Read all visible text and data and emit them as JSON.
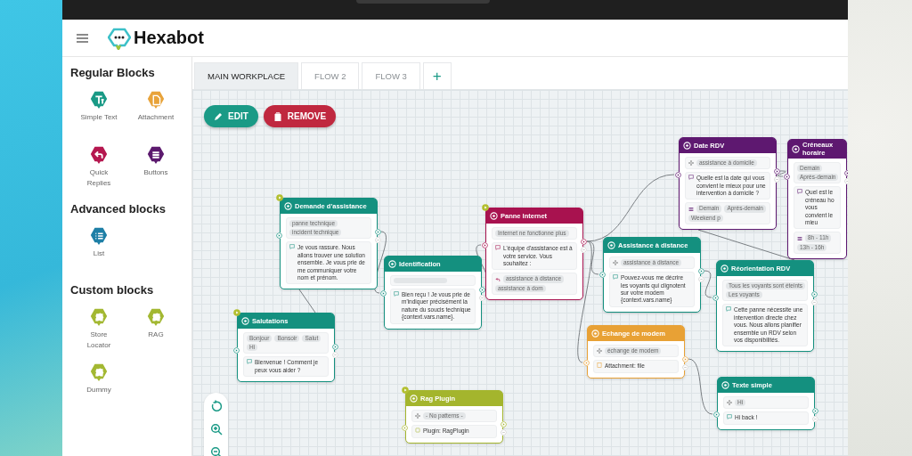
{
  "header": {
    "title": "Hexabot"
  },
  "sidebar": {
    "sections": [
      {
        "title": "Regular Blocks",
        "blocks": [
          {
            "label": "Simple Text",
            "kind": "text",
            "color": "#1a9a86"
          },
          {
            "label": "Attachment",
            "kind": "attachment",
            "color": "#e8a33a"
          },
          {
            "label": "Quick Replies",
            "kind": "quick_replies",
            "color": "#b5174f"
          },
          {
            "label": "Buttons",
            "kind": "buttons",
            "color": "#5c1a6e"
          }
        ]
      },
      {
        "title": "Advanced blocks",
        "blocks": [
          {
            "label": "List",
            "kind": "list",
            "color": "#1e7fa6"
          }
        ]
      },
      {
        "title": "Custom blocks",
        "blocks": [
          {
            "label": "Store Locator",
            "kind": "plugin",
            "color": "#a3b832"
          },
          {
            "label": "RAG",
            "kind": "plugin",
            "color": "#a3b832"
          },
          {
            "label": "Dummy",
            "kind": "plugin",
            "color": "#a3b832"
          }
        ]
      }
    ]
  },
  "tabs": [
    {
      "label": "MAIN WORKPLACE",
      "selected": true
    },
    {
      "label": "FLOW 2",
      "selected": false
    },
    {
      "label": "FLOW 3",
      "selected": false
    },
    {
      "label": "+",
      "selected": false
    }
  ],
  "actions": {
    "edit": "EDIT",
    "remove": "REMOVE"
  },
  "nodes": [
    {
      "title": "Demande d'assistance",
      "color": "#14907f",
      "starting": true,
      "patterns": {
        "kind": "keywords",
        "items": [
          "panne technique",
          "incident technique"
        ]
      },
      "message": {
        "kind": "text",
        "text": "Je vous rassure. Nous allons trouver une solution ensemble. Je vous prie de me communiquer votre nom et prénom."
      }
    },
    {
      "title": "Salutations",
      "color": "#14907f",
      "starting": true,
      "patterns": {
        "kind": "keywords",
        "items": [
          "Bonjour",
          "Bonsoir",
          "Salut",
          "Hi"
        ]
      },
      "message": {
        "kind": "text",
        "text": "Bienvenue ! Comment je peux vous aider ?"
      }
    },
    {
      "title": "Identification",
      "color": "#14907f",
      "starting": false,
      "patterns": {
        "kind": "regex"
      },
      "message": {
        "kind": "text",
        "text": "Bien reçu ! Je vous prie de m'indiquer précisément la nature du soucis technique {context.vars.name}."
      }
    },
    {
      "title": "Panne Internet",
      "color": "#a8124f",
      "starting": true,
      "patterns": {
        "kind": "keywords",
        "items": [
          "Internet ne fonctionne plus"
        ]
      },
      "message": {
        "kind": "text",
        "text": "L'équipe d'assistance est à votre service. Vous souhaitez :"
      },
      "replies": {
        "kind": "quick_replies",
        "items": [
          "assistance à distance",
          "assistance à dom"
        ]
      }
    },
    {
      "title": "Assistance à distance",
      "color": "#14907f",
      "starting": false,
      "patterns": {
        "kind": "intent",
        "items": [
          "assistance à distance"
        ]
      },
      "message": {
        "kind": "text",
        "text": "Pouvez-vous me décrire les voyants qui clignotent sur votre modem {context.vars.name}"
      }
    },
    {
      "title": "Date RDV",
      "color": "#5e1870",
      "starting": false,
      "patterns": {
        "kind": "intent",
        "items": [
          "assistance à domicile"
        ]
      },
      "message": {
        "kind": "text",
        "text": "Quelle est la date qui vous convient le mieux pour une intervention à domicile ?"
      },
      "replies": {
        "kind": "buttons",
        "items": [
          "Demain",
          "Après-demain",
          "Weekend p"
        ]
      }
    },
    {
      "title": "Créneaux horaire",
      "color": "#5e1870",
      "starting": false,
      "patterns": {
        "kind": "keywords",
        "items": [
          "Demain",
          "Après-demain"
        ]
      },
      "message": {
        "kind": "text",
        "text": "Quel est le créneau ho vous convient le mieu"
      },
      "replies": {
        "kind": "buttons",
        "items": [
          "8h - 11h",
          "13h - 16h"
        ]
      }
    },
    {
      "title": "Réorientation RDV",
      "color": "#14907f",
      "starting": false,
      "patterns": {
        "kind": "keywords",
        "items": [
          "Tous les voyants sont éteints",
          "Les voyants"
        ]
      },
      "message": {
        "kind": "text",
        "text": "Cette panne nécessite une intervention directe chez vous. Nous allons planifier ensemble un RDV selon vos disponibilités."
      }
    },
    {
      "title": "Echange de modem",
      "color": "#e8a135",
      "starting": false,
      "patterns": {
        "kind": "intent",
        "items": [
          "échange de modem"
        ]
      },
      "message": {
        "kind": "attachment",
        "text": "Attachment: file"
      }
    },
    {
      "title": "Texte simple",
      "color": "#14907f",
      "starting": false,
      "patterns": {
        "kind": "intent",
        "items": [
          "Hi"
        ]
      },
      "message": {
        "kind": "text",
        "text": "Hi back !"
      }
    },
    {
      "title": "Rag Plugin",
      "color": "#a4b52d",
      "starting": true,
      "patterns": {
        "kind": "intent",
        "items": [
          "- No patterns -"
        ]
      },
      "message": {
        "kind": "plugin",
        "text": "Plugin: RagPlugin"
      }
    }
  ]
}
